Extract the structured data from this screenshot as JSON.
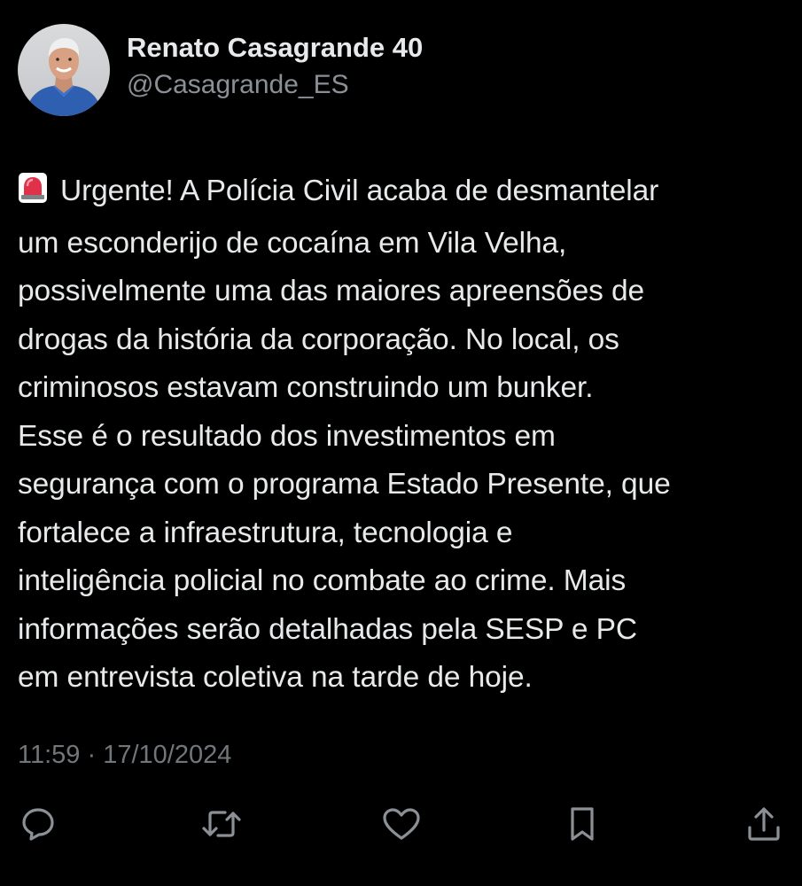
{
  "author": {
    "display_name": "Renato Casagrande 40",
    "handle": "@Casagrande_ES",
    "avatar_icon": "profile-photo"
  },
  "tweet": {
    "emoji_icon": "police-siren-icon",
    "lines": [
      "Urgente! A Polícia Civil acaba de desmantelar",
      "um esconderijo de cocaína em Vila Velha,",
      "possivelmente uma das maiores apreensões de",
      "drogas da história da corporação. No local, os",
      "criminosos estavam construindo um bunker.",
      "Esse é o resultado dos investimentos em",
      "segurança com o programa Estado Presente, que",
      "fortalece a infraestrutura, tecnologia e",
      "inteligência policial no combate ao crime. Mais",
      "informações serão detalhadas pela SESP e PC",
      "em entrevista coletiva na tarde de hoje."
    ],
    "timestamp": "11:59 · 17/10/2024"
  },
  "actions": [
    {
      "name": "reply",
      "icon": "reply-bubble-icon"
    },
    {
      "name": "retweet",
      "icon": "retweet-icon"
    },
    {
      "name": "like",
      "icon": "heart-icon"
    },
    {
      "name": "bookmark",
      "icon": "bookmark-icon"
    },
    {
      "name": "share",
      "icon": "share-icon"
    }
  ],
  "colors": {
    "background": "#000000",
    "primary_text": "#e7e9ea",
    "secondary_text": "#71767b",
    "icon": "#8b9096",
    "siren_red": "#e0314a"
  }
}
